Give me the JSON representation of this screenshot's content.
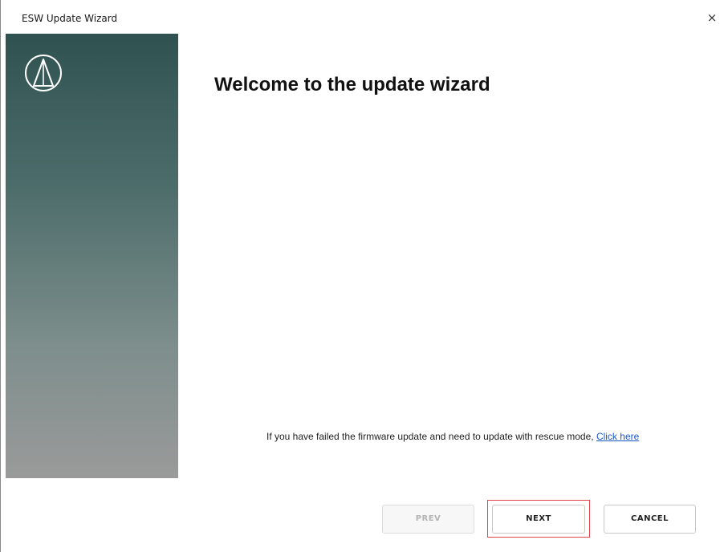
{
  "window": {
    "title": "ESW Update Wizard",
    "close_glyph": "×"
  },
  "sidebar": {
    "logo_icon": "audio-technica-logo-icon",
    "gradient_top": "#2f5250",
    "gradient_bottom": "#9a9a9a"
  },
  "main": {
    "heading": "Welcome to the update wizard",
    "rescue_text": "If you have failed the firmware update and need to update with rescue mode, ",
    "rescue_link": "Click here"
  },
  "buttons": {
    "prev_label": "PREV",
    "prev_enabled": false,
    "next_label": "NEXT",
    "cancel_label": "CANCEL"
  },
  "colors": {
    "link": "#1a56c4",
    "highlight": "#e0454f"
  }
}
